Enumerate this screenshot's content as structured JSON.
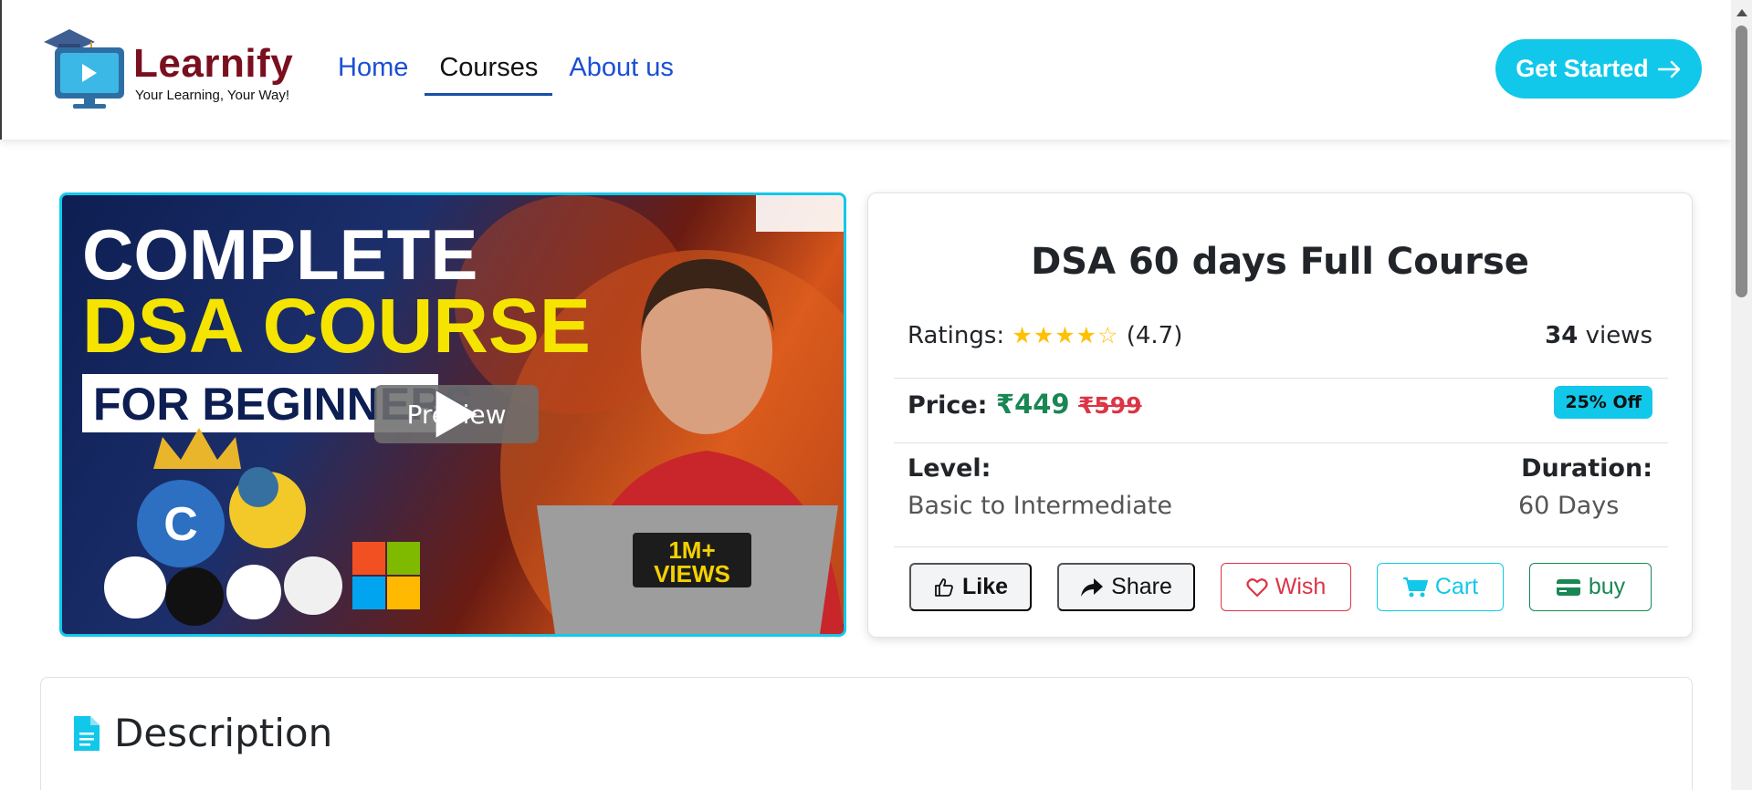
{
  "brand": {
    "name": "Learnify",
    "tagline": "Your Learning, Your Way!"
  },
  "nav": {
    "links": [
      {
        "label": "Home",
        "active": false
      },
      {
        "label": "Courses",
        "active": true
      },
      {
        "label": "About us",
        "active": false
      }
    ],
    "cta_label": "Get Started",
    "cta_icon": "arrow-right-icon"
  },
  "hero": {
    "thumbnail_text": [
      "COMPLETE",
      "DSA COURSE",
      "FOR BEGINNERS",
      "1M+",
      "VIEWS"
    ],
    "preview_label": "Preview"
  },
  "course": {
    "title": "DSA 60 days Full Course",
    "ratings_label": "Ratings:",
    "stars": "★★★★☆",
    "rating_value": "(4.7)",
    "views_count": "34",
    "views_label": "views",
    "price_label": "Price:",
    "price_new": "₹449",
    "price_old": "₹599",
    "discount_badge": "25% Off",
    "level_label": "Level:",
    "level_value": "Basic to Intermediate",
    "duration_label": "Duration:",
    "duration_value": "60 Days"
  },
  "actions": {
    "like": "Like",
    "share": "Share",
    "wish": "Wish",
    "cart": "Cart",
    "buy": "buy"
  },
  "description": {
    "heading": "Description"
  },
  "colors": {
    "accent": "#12c8ea",
    "brand": "#7a0f1f",
    "link": "#1a4fd6",
    "price_new": "#198754",
    "price_old": "#dc3545",
    "star": "#ffc107"
  }
}
